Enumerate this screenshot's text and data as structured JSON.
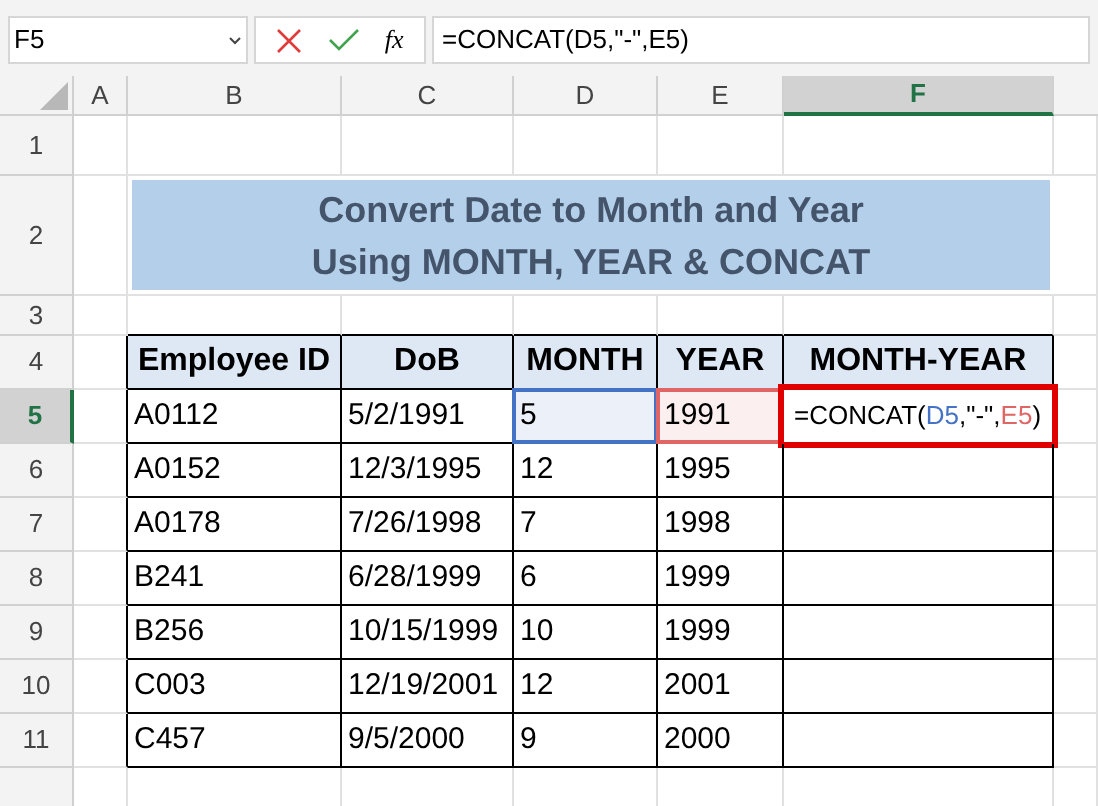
{
  "name_box": {
    "value": "F5"
  },
  "formula_bar": {
    "function_label": "fx",
    "formula": "=CONCAT(D5,\"-\",E5)"
  },
  "columns": [
    {
      "label": "A",
      "selected": false
    },
    {
      "label": "B",
      "selected": false
    },
    {
      "label": "C",
      "selected": false
    },
    {
      "label": "D",
      "selected": false
    },
    {
      "label": "E",
      "selected": false
    },
    {
      "label": "F",
      "selected": true
    }
  ],
  "row_headers": [
    {
      "label": "1",
      "selected": false
    },
    {
      "label": "2",
      "selected": false
    },
    {
      "label": "3",
      "selected": false
    },
    {
      "label": "4",
      "selected": false
    },
    {
      "label": "5",
      "selected": true
    },
    {
      "label": "6",
      "selected": false
    },
    {
      "label": "7",
      "selected": false
    },
    {
      "label": "8",
      "selected": false
    },
    {
      "label": "9",
      "selected": false
    },
    {
      "label": "10",
      "selected": false
    },
    {
      "label": "11",
      "selected": false
    }
  ],
  "title": [
    "Convert Date to Month and Year",
    "Using MONTH, YEAR & CONCAT"
  ],
  "table": {
    "columns": [
      "Employee ID",
      "DoB",
      "MONTH",
      "YEAR",
      "MONTH-YEAR"
    ],
    "rows": [
      [
        {
          "text": "A0112"
        },
        {
          "text": "5/2/1991"
        },
        {
          "text": "5",
          "color": "#4472c4"
        },
        {
          "text": "1991",
          "color": "#e06666"
        },
        {
          "editing": [
            {
              "text": "=CONCAT(",
              "color": "#000000"
            },
            {
              "text": "D5",
              "color": "#4472c4"
            },
            {
              "text": ",\"-\",",
              "color": "#000000"
            },
            {
              "text": "E5",
              "color": "#e06666"
            },
            {
              "text": ")",
              "color": "#000000"
            }
          ]
        }
      ],
      [
        {
          "text": "A0152"
        },
        {
          "text": "12/3/1995"
        },
        {
          "text": "12"
        },
        {
          "text": "1995"
        },
        {
          "text": ""
        }
      ],
      [
        {
          "text": "A0178"
        },
        {
          "text": "7/26/1998"
        },
        {
          "text": "7"
        },
        {
          "text": "1998"
        },
        {
          "text": ""
        }
      ],
      [
        {
          "text": "B241"
        },
        {
          "text": "6/28/1999"
        },
        {
          "text": "6"
        },
        {
          "text": "1999"
        },
        {
          "text": ""
        }
      ],
      [
        {
          "text": "B256"
        },
        {
          "text": "10/15/1999"
        },
        {
          "text": "10"
        },
        {
          "text": "1999"
        },
        {
          "text": ""
        }
      ],
      [
        {
          "text": "C003"
        },
        {
          "text": "12/19/2001"
        },
        {
          "text": "12"
        },
        {
          "text": "2001"
        },
        {
          "text": ""
        }
      ],
      [
        {
          "text": "C457"
        },
        {
          "text": "9/5/2000"
        },
        {
          "text": "9"
        },
        {
          "text": "2000"
        },
        {
          "text": ""
        }
      ]
    ]
  }
}
